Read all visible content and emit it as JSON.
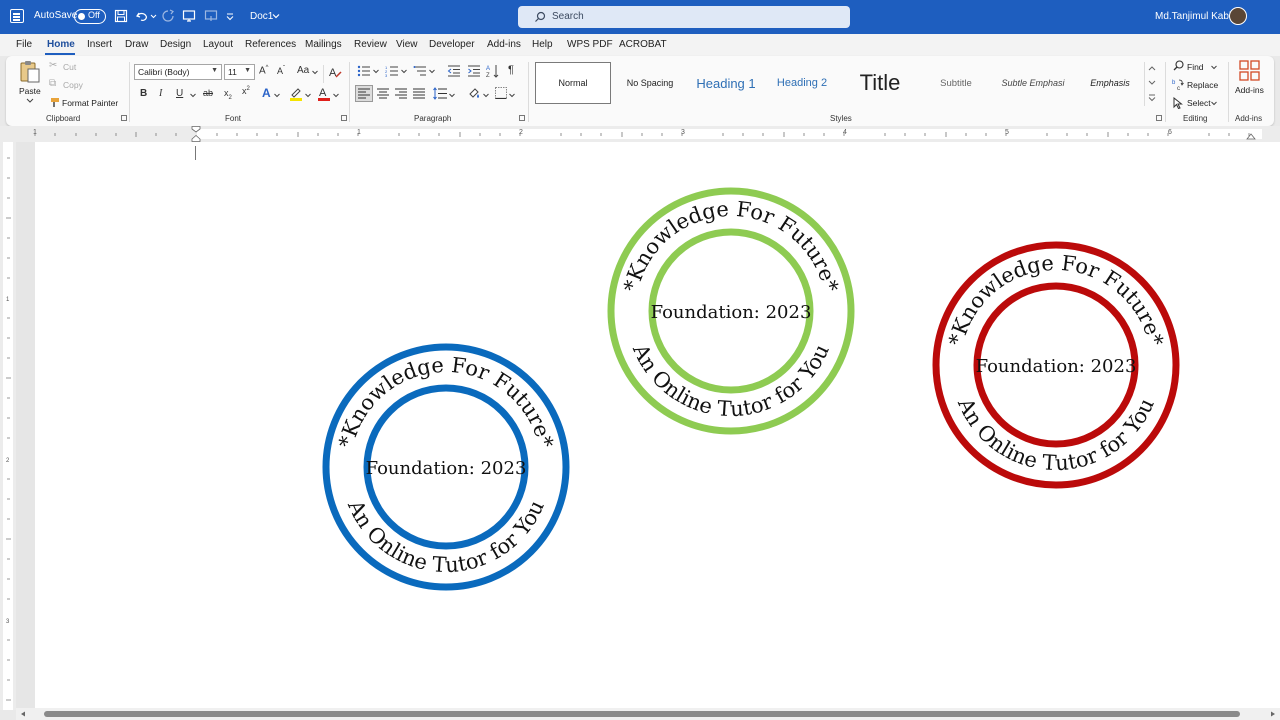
{
  "titlebar": {
    "autosave_label": "AutoSave",
    "toggle_state": "Off",
    "doc_name": "Doc1",
    "search_placeholder": "Search",
    "user_name": "Md.Tanjimul Kabir",
    "bg_color": "#1e5ebf"
  },
  "menu": {
    "tabs": [
      "File",
      "Home",
      "Insert",
      "Draw",
      "Design",
      "Layout",
      "References",
      "Mailings",
      "Review",
      "View",
      "Developer",
      "Add-ins",
      "Help",
      "WPS PDF",
      "ACROBAT"
    ],
    "active": "Home"
  },
  "ribbon": {
    "clipboard": {
      "paste": "Paste",
      "cut": "Cut",
      "copy": "Copy",
      "format_painter": "Format Painter",
      "label": "Clipboard"
    },
    "font": {
      "font_name": "Calibri (Body)",
      "font_size": "11",
      "label": "Font"
    },
    "paragraph": {
      "label": "Paragraph"
    },
    "styles": {
      "items": [
        "Normal",
        "No Spacing",
        "Heading 1",
        "Heading 2",
        "Title",
        "Subtitle",
        "Subtle Emphasi",
        "Emphasis"
      ],
      "label": "Styles"
    },
    "editing": {
      "find": "Find",
      "replace": "Replace",
      "select": "Select",
      "label": "Editing"
    },
    "addins": {
      "button": "Add-ins",
      "label": "Add-ins"
    }
  },
  "ruler": {
    "numbers": [
      "1",
      "1",
      "2",
      "3",
      "4",
      "5",
      "6"
    ]
  },
  "stamps": [
    {
      "top_text": "*Knowledge For Future*",
      "center_text": "Foundation: 2023",
      "bottom_text": "An Online Tutor for You",
      "color": "#0a6abd"
    },
    {
      "top_text": "*Knowledge For Future*",
      "center_text": "Foundation: 2023",
      "bottom_text": "An Online Tutor for You",
      "color": "#8ecb52"
    },
    {
      "top_text": "*Knowledge For Future*",
      "center_text": "Foundation: 2023",
      "bottom_text": "An Online Tutor for You",
      "color": "#bb0a0a"
    }
  ]
}
